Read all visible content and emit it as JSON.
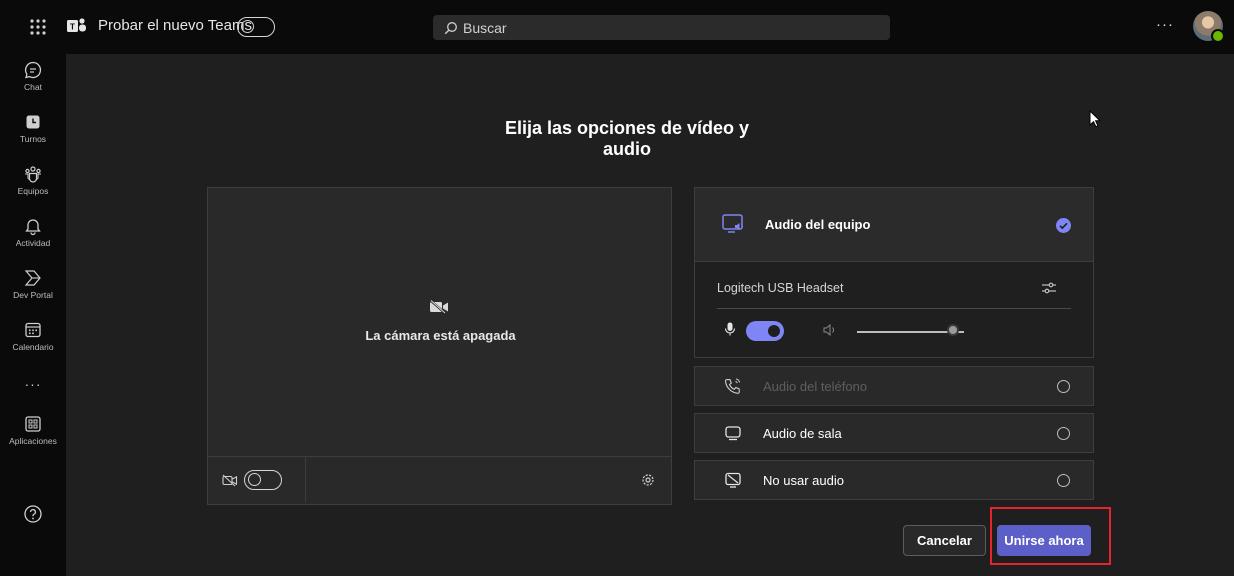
{
  "topbar": {
    "try_label": "Probar el nuevo Teams",
    "search_placeholder": "Buscar",
    "more_label": "···"
  },
  "rail": {
    "items": [
      {
        "label": "Chat",
        "icon": "chat-icon"
      },
      {
        "label": "Turnos",
        "icon": "shifts-icon"
      },
      {
        "label": "Equipos",
        "icon": "teams-icon"
      },
      {
        "label": "Actividad",
        "icon": "bell-icon"
      },
      {
        "label": "Dev Portal",
        "icon": "dev-portal-icon"
      },
      {
        "label": "Calendario",
        "icon": "calendar-icon"
      },
      {
        "label": "Aplicaciones",
        "icon": "apps-icon"
      }
    ],
    "more_label": "···"
  },
  "main": {
    "title": "Elija las opciones de vídeo y audio",
    "camera_off_text": "La cámara está apagada"
  },
  "audio": {
    "computer_audio": {
      "label": "Audio del equipo",
      "selected": true
    },
    "device_name": "Logitech USB Headset",
    "mic_on": true,
    "volume_level": 0.9,
    "options": [
      {
        "label": "Audio del teléfono",
        "enabled": false
      },
      {
        "label": "Audio de sala",
        "enabled": true
      },
      {
        "label": "No usar audio",
        "enabled": true
      }
    ]
  },
  "actions": {
    "cancel_label": "Cancelar",
    "join_label": "Unirse ahora"
  },
  "colors": {
    "accent": "#5b5fc7",
    "accent_light": "#7f85f5",
    "highlight_box": "#e4262b",
    "presence": "#6bb700"
  }
}
